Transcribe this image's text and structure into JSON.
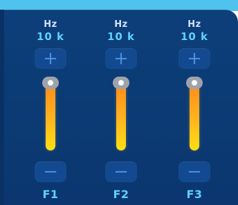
{
  "equalizer": {
    "channels": [
      {
        "unit": "Hz",
        "frequency": "10 k",
        "plus": "+",
        "minus": "−",
        "label": "F1",
        "level": 1.0
      },
      {
        "unit": "Hz",
        "frequency": "10 k",
        "plus": "+",
        "minus": "−",
        "label": "F2",
        "level": 1.0
      },
      {
        "unit": "Hz",
        "frequency": "10 k",
        "plus": "+",
        "minus": "−",
        "label": "F3",
        "level": 1.0
      }
    ],
    "colors": {
      "panel": "#0c3a73",
      "accent_text": "#5fd0ff",
      "button": "#13498f",
      "slider_top": "#ff8c1a",
      "slider_bottom": "#ffe012",
      "knob": "#9ea3ab"
    },
    "icons": {
      "plus": "plus-icon",
      "minus": "minus-icon"
    }
  }
}
